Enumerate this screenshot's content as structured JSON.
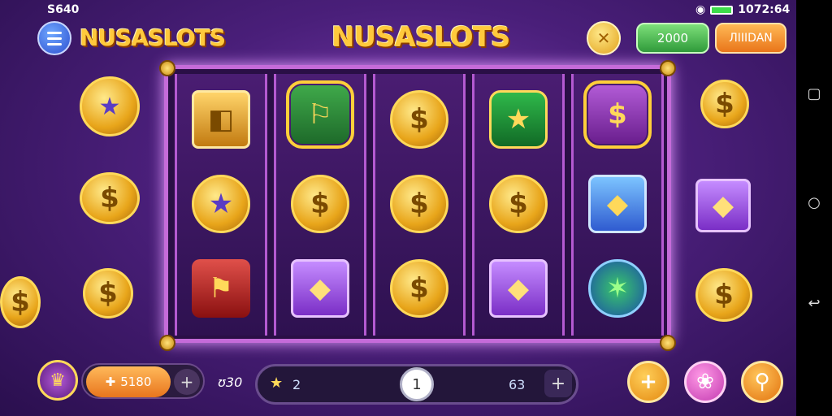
{
  "status_bar": {
    "left_text": "S640",
    "time": "1072:64"
  },
  "header": {
    "logo_left": "NUSASLOTS",
    "title": "NUSASLOTS",
    "balance_label": "2000",
    "action_label": "ЛIIIDAN"
  },
  "reels": [
    {
      "symbols": [
        "chest-gold",
        "coin",
        "chest-gold"
      ]
    },
    {
      "symbols": [
        "pennant",
        "coin-stack",
        "chest"
      ]
    },
    {
      "symbols": [
        "coin",
        "coin-stack",
        "coin"
      ]
    },
    {
      "symbols": [
        "card-star",
        "coin",
        "chest"
      ]
    },
    {
      "symbols": [
        "coin-gift",
        "gem",
        "star-coin"
      ]
    }
  ],
  "bottom": {
    "bet_value": "5180",
    "bet_label": "ʊ30",
    "star_value": "2",
    "spin_count": "1",
    "lines_value": "63"
  },
  "icons": {
    "menu": "menu-icon",
    "coin_badge": "coin-icon",
    "plus": "plus-icon",
    "gift": "gift-icon",
    "search": "search-icon",
    "star": "star-icon"
  }
}
